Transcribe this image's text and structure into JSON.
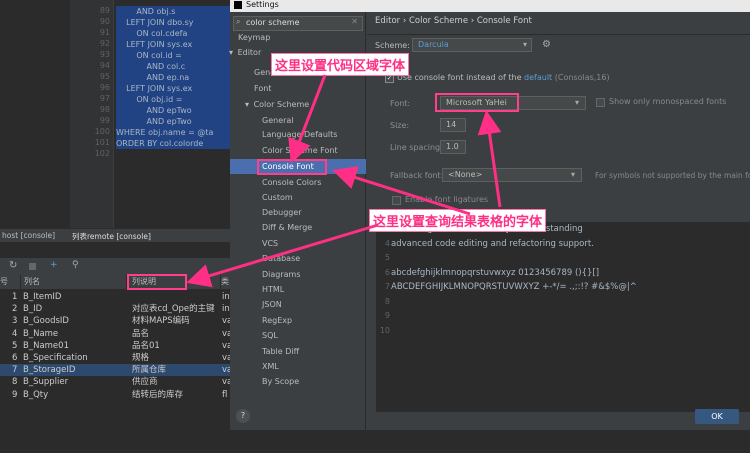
{
  "editor": {
    "line_numbers": [
      "89",
      "90",
      "91",
      "92",
      "93",
      "94",
      "95",
      "96",
      "97",
      "98",
      "99",
      "100",
      "101",
      "102"
    ],
    "code_lines": [
      {
        "text": "        AND obj.s",
        "sel": true
      },
      {
        "text": "    LEFT JOIN dbo.sy",
        "sel": true
      },
      {
        "text": "        ON col.cdefa",
        "sel": true
      },
      {
        "text": "    LEFT JOIN sys.ex",
        "sel": true
      },
      {
        "text": "        ON col.id =",
        "sel": true
      },
      {
        "text": "            AND col.c",
        "sel": true
      },
      {
        "text": "            AND ep.na",
        "sel": true
      },
      {
        "text": "    LEFT JOIN sys.ex",
        "sel": true
      },
      {
        "text": "        ON obj.id =",
        "sel": true
      },
      {
        "text": "            AND epTwo",
        "sel": true
      },
      {
        "text": "            AND epTwo",
        "sel": true
      },
      {
        "text": "WHERE obj.name = @ta",
        "sel": true
      },
      {
        "text": "ORDER BY col.colorde",
        "sel": true
      },
      {
        "text": "",
        "sel": false
      }
    ]
  },
  "console": {
    "tab1": "host [console]",
    "tab2": "列表remote [console]",
    "headers": {
      "num": "号",
      "col1": "列名",
      "col2": "列说明",
      "col3": "类"
    },
    "rows": [
      {
        "n": "1",
        "name": "B_ItemID",
        "desc": "",
        "t": "in"
      },
      {
        "n": "2",
        "name": "B_ID",
        "desc": "对应表cd_Ope的主键",
        "t": "in"
      },
      {
        "n": "3",
        "name": "B_GoodsID",
        "desc": "材料MAPS编码",
        "t": "va"
      },
      {
        "n": "4",
        "name": "B_Name",
        "desc": "品名",
        "t": "va"
      },
      {
        "n": "5",
        "name": "B_Name01",
        "desc": "品名01",
        "t": "va"
      },
      {
        "n": "6",
        "name": "B_Specification",
        "desc": "规格",
        "t": "va"
      },
      {
        "n": "7",
        "name": "B_StorageID",
        "desc": "所属仓库",
        "t": "va"
      },
      {
        "n": "8",
        "name": "B_Supplier",
        "desc": "供应商",
        "t": "va"
      },
      {
        "n": "9",
        "name": "B_Qty",
        "desc": "结转后的库存",
        "t": "fl"
      }
    ]
  },
  "settings": {
    "window_title": "Settings",
    "search_value": "color scheme",
    "breadcrumb": "Editor  ›  Color Scheme  ›  Console Font",
    "tree": [
      "Keymap",
      "Editor",
      "General",
      "Font",
      "Color Scheme",
      "General",
      "Language Defaults",
      "Color Scheme Font",
      "Console Font",
      "Console Colors",
      "Custom",
      "Debugger",
      "Diff & Merge",
      "VCS",
      "Database",
      "Diagrams",
      "HTML",
      "JSON",
      "RegExp",
      "SQL",
      "Table Diff",
      "XML",
      "By Scope"
    ],
    "scheme_label": "Scheme:",
    "scheme_value": "Darcula",
    "use_console_font": "Use console font instead of the ",
    "default_link": "default",
    "default_suffix": " (Consolas,16)",
    "font_label": "Font:",
    "font_value": "Microsoft YaHei",
    "mono_only": "Show only monospaced fonts",
    "size_label": "Size:",
    "size_value": "14",
    "spacing_label": "Line spacing:",
    "spacing_value": "1.0",
    "fallback_label": "Fallback font:",
    "fallback_value": "<None>",
    "fallback_note": "For symbols not supported by the main font",
    "ligatures": "Enable font ligatures",
    "preview_lines": [
      "with a high level of usability and outstanding",
      "advanced code editing and refactoring support.",
      "",
      "abcdefghijklmnopqrstuvwxyz 0123456789 (){}[]",
      "ABCDEFGHIJKLMNOPQRSTUVWXYZ +-*/= .,;:!? #&$%@|^",
      "",
      "",
      ""
    ],
    "preview_numbers": [
      "3",
      "4",
      "5",
      "6",
      "7",
      "8",
      "9",
      "10"
    ],
    "ok": "OK",
    "help": "?"
  },
  "annotations": {
    "callout1": "这里设置代码区域字体",
    "callout2": "这里设置查询结果表格的字体"
  },
  "colors": {
    "accent": "#ff3f8b",
    "selection": "#214283"
  }
}
